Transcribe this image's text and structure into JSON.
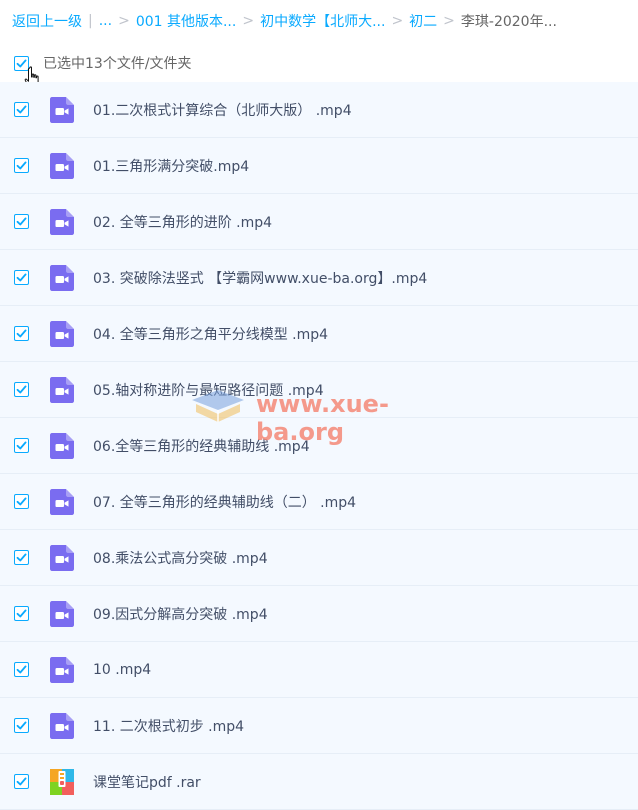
{
  "breadcrumb": {
    "back": "返回上一级",
    "ellipsis": "...",
    "path": [
      "001 其他版本...",
      "初中数学【北师大...",
      "初二"
    ],
    "current": "李琪-2020年..."
  },
  "selection": {
    "label": "已选中13个文件/文件夹"
  },
  "files": [
    {
      "name": "01.二次根式计算综合（北师大版） .mp4",
      "type": "video"
    },
    {
      "name": "01.三角形满分突破.mp4",
      "type": "video"
    },
    {
      "name": "02. 全等三角形的进阶 .mp4",
      "type": "video"
    },
    {
      "name": "03. 突破除法竖式 【学霸网www.xue-ba.org】.mp4",
      "type": "video"
    },
    {
      "name": "04. 全等三角形之角平分线模型 .mp4",
      "type": "video"
    },
    {
      "name": "05.轴对称进阶与最短路径问题 .mp4",
      "type": "video"
    },
    {
      "name": "06.全等三角形的经典辅助线 .mp4",
      "type": "video"
    },
    {
      "name": "07. 全等三角形的经典辅助线（二） .mp4",
      "type": "video"
    },
    {
      "name": "08.乘法公式高分突破 .mp4",
      "type": "video"
    },
    {
      "name": "09.因式分解高分突破 .mp4",
      "type": "video"
    },
    {
      "name": "10 .mp4",
      "type": "video"
    },
    {
      "name": "11. 二次根式初步 .mp4",
      "type": "video"
    },
    {
      "name": "课堂笔记pdf .rar",
      "type": "archive"
    }
  ],
  "watermark": "www.xue-ba.org",
  "colors": {
    "accent": "#09aaff",
    "video_icon": "#7a6cf0",
    "row_bg": "#f4f9ff"
  }
}
